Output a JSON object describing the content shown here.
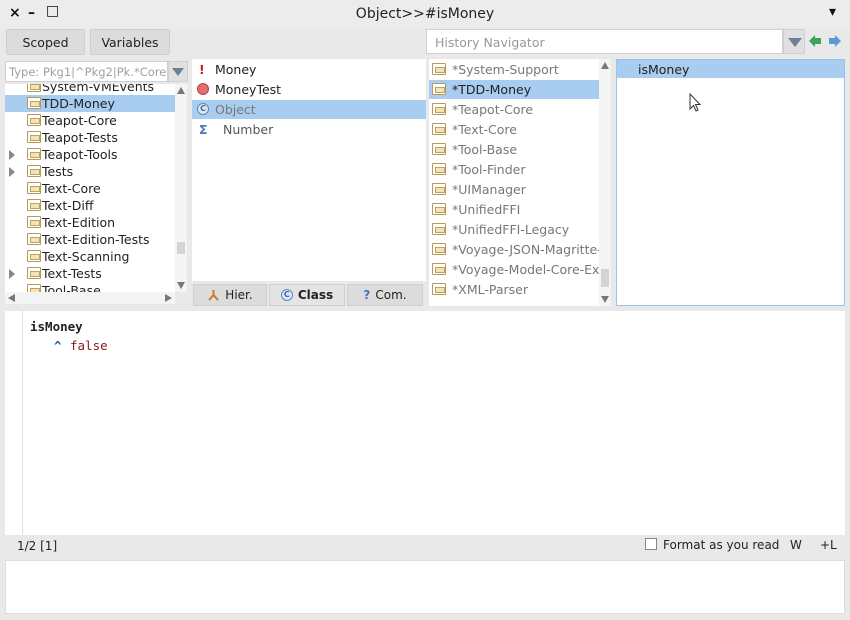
{
  "window": {
    "title": "Object>>#isMoney",
    "close_icon": "×",
    "minimize_icon": "–",
    "maximize_icon": "□",
    "menu_icon": "▾"
  },
  "toolbar": {
    "scoped_label": "Scoped",
    "variables_label": "Variables",
    "history_placeholder": "History Navigator"
  },
  "packages": {
    "filter_placeholder": "Type: Pkg1|^Pkg2|Pk.*Core$",
    "items": [
      {
        "label": "System-VMEvents",
        "expandable": false,
        "selected": false
      },
      {
        "label": "TDD-Money",
        "expandable": false,
        "selected": true
      },
      {
        "label": "Teapot-Core",
        "expandable": false,
        "selected": false
      },
      {
        "label": "Teapot-Tests",
        "expandable": false,
        "selected": false
      },
      {
        "label": "Teapot-Tools",
        "expandable": true,
        "selected": false
      },
      {
        "label": "Tests",
        "expandable": true,
        "selected": false
      },
      {
        "label": "Text-Core",
        "expandable": false,
        "selected": false
      },
      {
        "label": "Text-Diff",
        "expandable": false,
        "selected": false
      },
      {
        "label": "Text-Edition",
        "expandable": false,
        "selected": false
      },
      {
        "label": "Text-Edition-Tests",
        "expandable": false,
        "selected": false
      },
      {
        "label": "Text-Scanning",
        "expandable": false,
        "selected": false
      },
      {
        "label": "Text-Tests",
        "expandable": true,
        "selected": false
      },
      {
        "label": "Tool-Base",
        "expandable": false,
        "selected": false
      }
    ]
  },
  "classes": {
    "items": [
      {
        "label": "Money",
        "icon": "exclamation-icon",
        "icon_glyph": "!",
        "selected": false
      },
      {
        "label": "MoneyTest",
        "icon": "red-circle-icon",
        "icon_glyph": "",
        "selected": false
      },
      {
        "label": "Object",
        "icon": "class-icon",
        "icon_glyph": "C",
        "selected": true
      },
      {
        "label": "Number",
        "icon": "sigma-icon",
        "icon_glyph": "Σ",
        "selected": false
      }
    ],
    "buttons": {
      "hier_label": "Hier.",
      "class_label": "Class",
      "com_label": "Com."
    }
  },
  "protocols": {
    "items": [
      {
        "label": "*System-Support",
        "selected": false
      },
      {
        "label": "*TDD-Money",
        "selected": true
      },
      {
        "label": "*Teapot-Core",
        "selected": false
      },
      {
        "label": "*Text-Core",
        "selected": false
      },
      {
        "label": "*Tool-Base",
        "selected": false
      },
      {
        "label": "*Tool-Finder",
        "selected": false
      },
      {
        "label": "*UIManager",
        "selected": false
      },
      {
        "label": "*UnifiedFFI",
        "selected": false
      },
      {
        "label": "*UnifiedFFI-Legacy",
        "selected": false
      },
      {
        "label": "*Voyage-JSON-Magritte-Ext",
        "selected": false
      },
      {
        "label": "*Voyage-Model-Core-Exten",
        "selected": false
      },
      {
        "label": "*XML-Parser",
        "selected": false
      }
    ]
  },
  "methods": {
    "items": [
      {
        "label": "isMoney",
        "selected": true
      }
    ]
  },
  "editor": {
    "line1": "isMoney",
    "line2_caret": "^",
    "line2_value": "false"
  },
  "status": {
    "position": "1/2 [1]",
    "format_label": "Format as you read",
    "w_label": "W",
    "l_label": "+L"
  },
  "colors": {
    "selection": "#a9cdf0",
    "false_keyword": "#8b1a1a",
    "arrow_green": "#3aa55a",
    "arrow_blue": "#5b9bd5"
  }
}
